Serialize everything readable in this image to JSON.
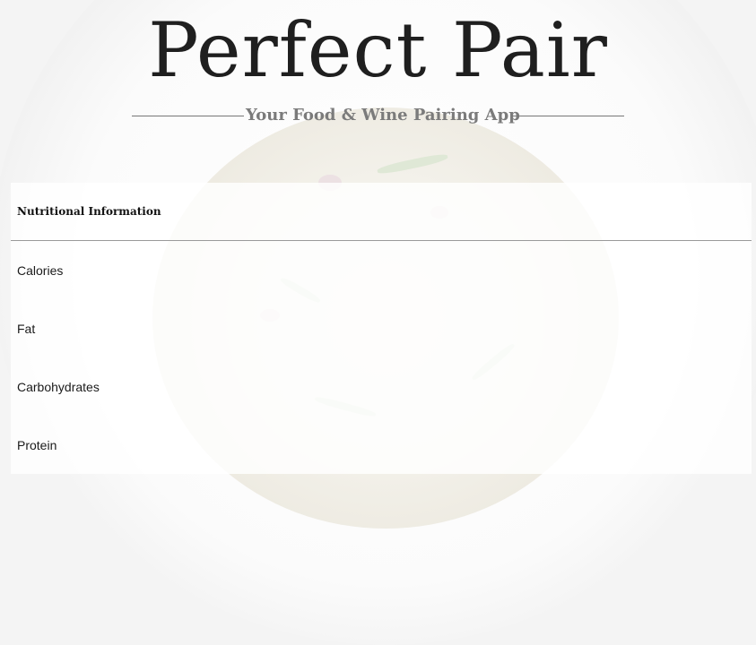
{
  "header": {
    "title": "Perfect Pair",
    "subtitle": "Your Food & Wine Pairing App"
  },
  "nutrition": {
    "heading": "Nutritional Information",
    "rows": [
      {
        "label": "Calories"
      },
      {
        "label": "Fat"
      },
      {
        "label": "Carbohydrates"
      },
      {
        "label": "Protein"
      }
    ]
  },
  "background": {
    "image": "risotto-in-white-bowl"
  }
}
